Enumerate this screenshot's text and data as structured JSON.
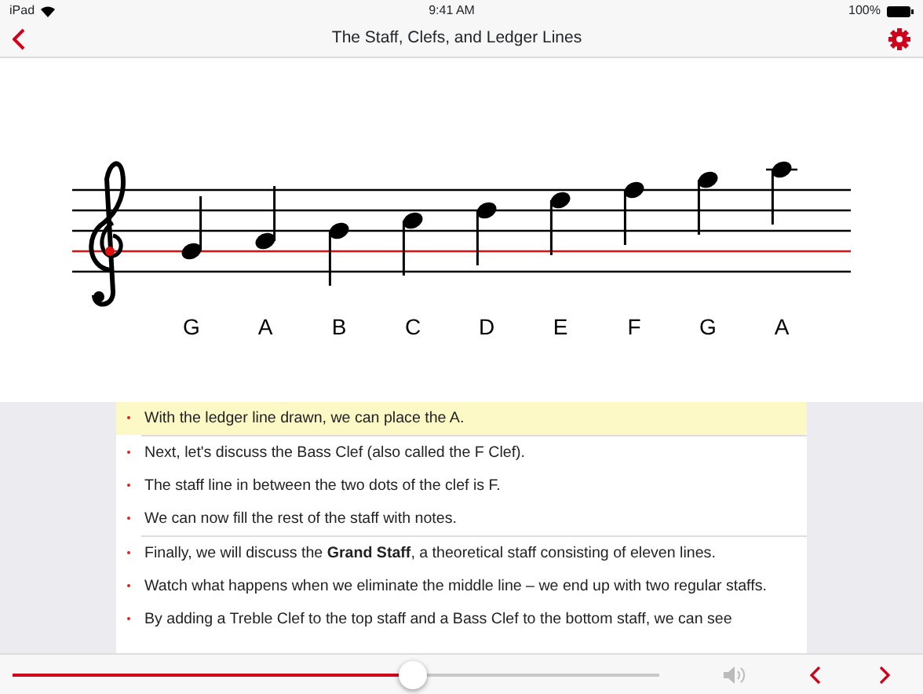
{
  "status_bar": {
    "device": "iPad",
    "time": "9:41 AM",
    "battery": "100%"
  },
  "nav_bar": {
    "title": "The Staff, Clefs, and Ledger Lines"
  },
  "notes": [
    {
      "name": "G"
    },
    {
      "name": "A"
    },
    {
      "name": "B"
    },
    {
      "name": "C"
    },
    {
      "name": "D"
    },
    {
      "name": "E"
    },
    {
      "name": "F"
    },
    {
      "name": "G"
    },
    {
      "name": "A"
    }
  ],
  "sections": [
    {
      "items": [
        {
          "text": "With the ledger line drawn, we can place the A.",
          "selected": true
        }
      ]
    },
    {
      "items": [
        {
          "text": "Next, let's discuss the Bass Clef (also called the F Clef).",
          "selected": false
        },
        {
          "text": "The staff line in between the two dots of the clef is F.",
          "selected": false
        },
        {
          "text": "We can now fill the rest of the staff with notes.",
          "selected": false
        }
      ]
    },
    {
      "items": [
        {
          "text": "Finally, we will discuss the **Grand Staff**, a theoretical staff consisting of eleven lines.",
          "selected": false
        },
        {
          "text": "Watch what happens when we eliminate the middle line – we end up with two regular staffs.",
          "selected": false
        },
        {
          "text": "By adding a Treble Clef to the top staff and a Bass Clef to the bottom staff, we can see",
          "selected": false
        }
      ]
    }
  ],
  "player": {
    "level": 0.62
  }
}
